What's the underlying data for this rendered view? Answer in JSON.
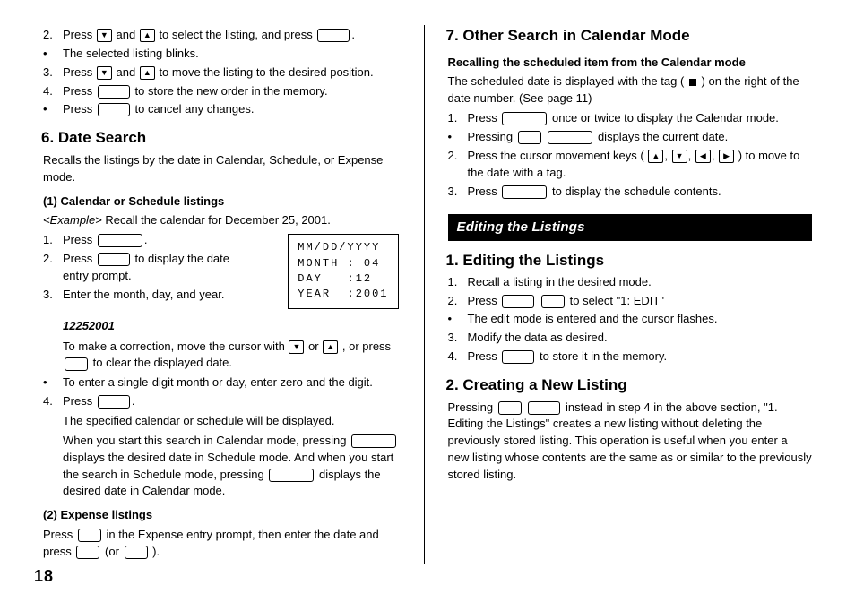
{
  "pageNumber": "18",
  "left": {
    "step2a": "Press",
    "step2b": "and",
    "step2c": "to select the listing, and press",
    "bullet1": "The selected listing blinks.",
    "step3a": "Press",
    "step3b": "and",
    "step3c": "to move the listing to the desired position.",
    "step4a": "Press",
    "step4b": "to store the new order in the memory.",
    "bullet2a": "Press",
    "bullet2b": "to cancel any changes.",
    "h6": "6. Date Search",
    "h6sub": "Recalls the listings by the date in Calendar, Schedule, or Expense mode.",
    "sec1": "(1) Calendar or Schedule listings",
    "ex1a": "<Example>",
    "ex1b": " Recall the calendar for December 25, 2001.",
    "d1a": "Press",
    "d2a": "Press",
    "d2b": "to display the date entry prompt.",
    "d3": "Enter the month, day, and year.",
    "d3code": "12252001",
    "lcd": "MM/DD/YYYY\nMONTH : 04\nDAY   :12\nYEAR  :2001",
    "corr1": "To make a correction, move the cursor with ",
    "corr2": " or ",
    "corr3": ", or press ",
    "corr4": " to clear the displayed date.",
    "bullet3": "To enter a single-digit month or day, enter zero and the digit.",
    "d4a": "Press",
    "d4para1": "The specified calendar or schedule will be displayed.",
    "d4para2a": "When you start this search in Calendar mode, pressing ",
    "d4para2b": " displays the desired date in Schedule mode. And when you start the search in Schedule mode, pressing ",
    "d4para2c": " displays the desired date in Calendar mode.",
    "sec2": "(2) Expense listings",
    "exp1": "Press ",
    "exp2": " in the Expense entry prompt, then enter the date and press ",
    "exp3": " (or ",
    "exp4": ")."
  },
  "right": {
    "h7": "7. Other Search in Calendar Mode",
    "h7sub": "Recalling the scheduled item from the Calendar mode",
    "h7p1a": "The scheduled date is displayed with the tag (",
    "h7p1b": ") on the right of the date number. (See page 11)",
    "r1a": "Press",
    "r1b": "once or twice to display the Calendar mode.",
    "rb1a": "Pressing",
    "rb1b": "displays the current date.",
    "r2a": "Press the cursor movement keys (",
    "r2b": ") to move to the date with a tag.",
    "r3a": "Press",
    "r3b": "to display the schedule contents.",
    "bar": "Editing the Listings",
    "eh1": "1. Editing the Listings",
    "e1": "Recall a listing in the desired mode.",
    "e2a": "Press",
    "e2b": "to select \"1: EDIT\"",
    "eb": "The edit mode is entered and the cursor flashes.",
    "e3": "Modify the data as desired.",
    "e4a": "Press",
    "e4b": "to store it in the memory.",
    "eh2": "2. Creating a New Listing",
    "cp1": "Pressing ",
    "cp2": " instead in step 4 in the above section, \"1. Editing the Listings\" creates a new listing without deleting the previously stored listing. This operation is useful when you enter a new listing whose contents are the same as or similar to the previously stored listing."
  }
}
